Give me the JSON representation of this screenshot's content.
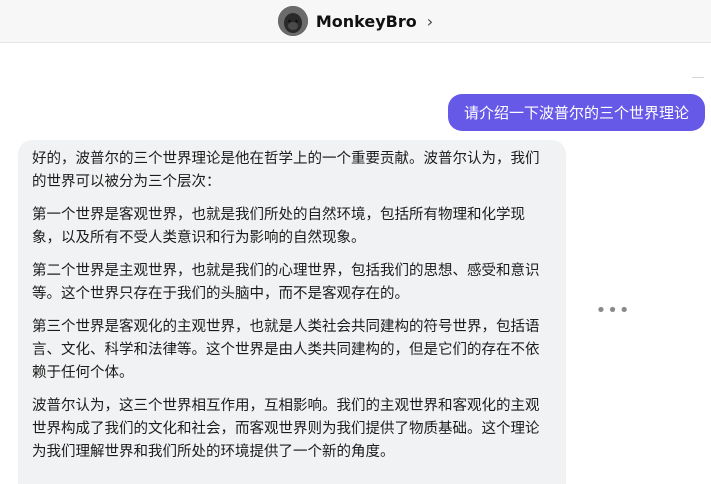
{
  "header": {
    "bot_name": "MonkeyBro",
    "chevron": "›",
    "avatar_icon": "avatar-icon"
  },
  "conversation": {
    "user_message": "请介绍一下波普尔的三个世界理论",
    "bot_paragraphs": [
      "好的，波普尔的三个世界理论是他在哲学上的一个重要贡献。波普尔认为，我们的世界可以被分为三个层次：",
      "第一个世界是客观世界，也就是我们所处的自然环境，包括所有物理和化学现象，以及所有不受人类意识和行为影响的自然现象。",
      "第二个世界是主观世界，也就是我们的心理世界，包括我们的思想、感受和意识等。这个世界只存在于我们的头脑中，而不是客观存在的。",
      "第三个世界是客观化的主观世界，也就是人类社会共同建构的符号世界，包括语言、文化、科学和法律等。这个世界是由人类共同建构的，但是它们的存在不依赖于任何个体。",
      "波普尔认为，这三个世界相互作用，互相影响。我们的主观世界和客观化的主观世界构成了我们的文化和社会，而客观世界则为我们提供了物质基础。这个理论为我们理解世界和我们所处的环境提供了一个新的角度。"
    ],
    "more_glyph": "•••"
  },
  "colors": {
    "user_bubble": "#6759e8",
    "bot_bubble": "#f1f2f3",
    "header_bg": "#f7f7f7"
  }
}
